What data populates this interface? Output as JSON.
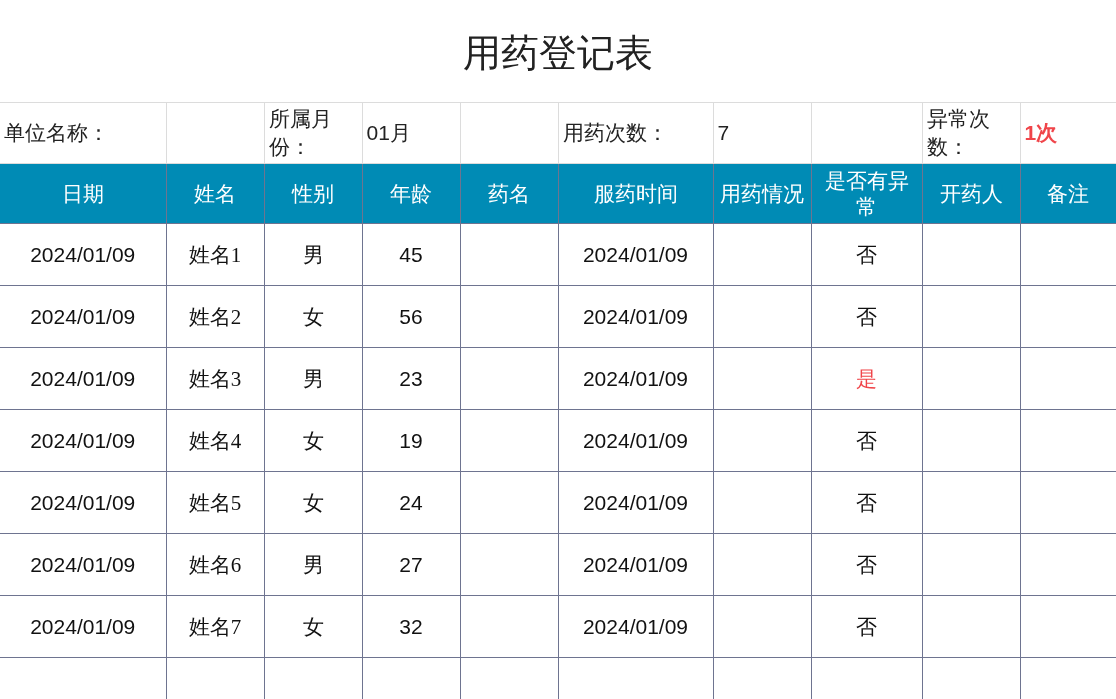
{
  "title": "用药登记表",
  "info": [
    {
      "label": "单位名称："
    },
    {
      "label": "所属月份：",
      "value": "01月",
      "highlighted": false
    },
    {
      "label": "用药次数：",
      "value": "7",
      "highlighted": false
    },
    {
      "label": "异常次数：",
      "value": "1次",
      "highlighted": true
    }
  ],
  "columns": [
    "日期",
    "姓名",
    "性别",
    "年龄",
    "药名",
    "服药时间",
    "用药情况",
    "是否有异常",
    "开药人",
    "备注"
  ],
  "rows": [
    {
      "date": "2024/01/09",
      "name": "姓名1",
      "gender": "男",
      "age": "45",
      "time": "2024/01/09",
      "abnormal": "否",
      "flagged": false
    },
    {
      "date": "2024/01/09",
      "name": "姓名2",
      "gender": "女",
      "age": "56",
      "time": "2024/01/09",
      "abnormal": "否",
      "flagged": false
    },
    {
      "date": "2024/01/09",
      "name": "姓名3",
      "gender": "男",
      "age": "23",
      "time": "2024/01/09",
      "abnormal": "是",
      "flagged": true
    },
    {
      "date": "2024/01/09",
      "name": "姓名4",
      "gender": "女",
      "age": "19",
      "time": "2024/01/09",
      "abnormal": "否",
      "flagged": false
    },
    {
      "date": "2024/01/09",
      "name": "姓名5",
      "gender": "女",
      "age": "24",
      "time": "2024/01/09",
      "abnormal": "否",
      "flagged": false
    },
    {
      "date": "2024/01/09",
      "name": "姓名6",
      "gender": "男",
      "age": "27",
      "time": "2024/01/09",
      "abnormal": "否",
      "flagged": false
    },
    {
      "date": "2024/01/09",
      "name": "姓名7",
      "gender": "女",
      "age": "32",
      "time": "2024/01/09",
      "abnormal": "否",
      "flagged": false
    }
  ]
}
